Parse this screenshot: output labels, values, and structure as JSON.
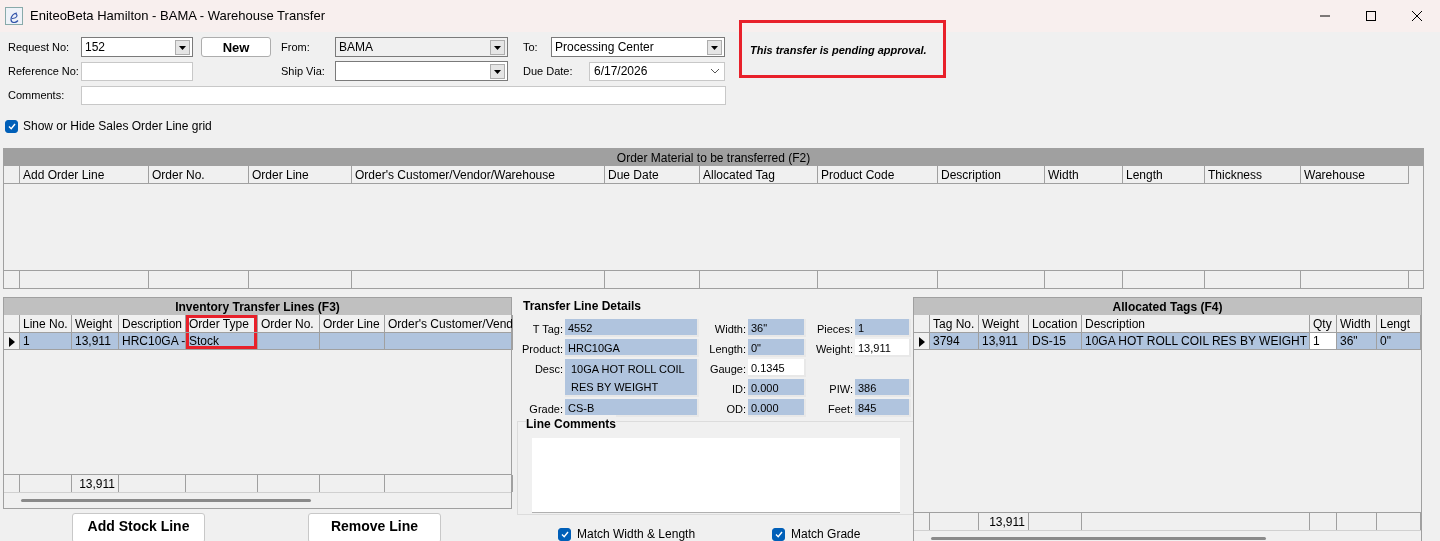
{
  "window": {
    "title": "EniteoBeta Hamilton - BAMA - Warehouse Transfer"
  },
  "header_form": {
    "request_no": {
      "label": "Request No:",
      "value": "152"
    },
    "new_button": "New",
    "from": {
      "label": "From:",
      "value": "BAMA",
      "disabled": true
    },
    "to": {
      "label": "To:",
      "value": "Processing Center",
      "disabled": false
    },
    "reference_no": {
      "label": "Reference No:"
    },
    "ship_via": {
      "label": "Ship Via:",
      "disabled": false
    },
    "due_date": {
      "label": "Due Date:",
      "value": "6/17/2026"
    },
    "comments": {
      "label": "Comments:"
    }
  },
  "notice": {
    "text": "This transfer is pending approval.",
    "highlighted": true
  },
  "show_grid_checkbox": {
    "label": "Show or Hide Sales Order Line grid",
    "checked": true
  },
  "order_material_grid": {
    "title": "Order Material to be transferred (F2)",
    "columns": [
      {
        "label": "Add Order Line"
      },
      {
        "label": "Order No."
      },
      {
        "label": "Order Line"
      },
      {
        "label": "Order's Customer/Vendor/Warehouse"
      },
      {
        "label": "Due Date"
      },
      {
        "label": "Allocated Tag"
      },
      {
        "label": "Product Code"
      },
      {
        "label": "Description"
      },
      {
        "label": "Width"
      },
      {
        "label": "Length"
      },
      {
        "label": "Thickness"
      },
      {
        "label": "Warehouse"
      }
    ]
  },
  "transfer_lines_grid": {
    "title": "Inventory Transfer Lines (F3)",
    "columns": [
      {
        "label": "Line No.",
        "highlighted": false
      },
      {
        "label": "Weight",
        "highlighted": false
      },
      {
        "label": "Description",
        "highlighted": false
      },
      {
        "label": "Order Type",
        "highlighted": true
      },
      {
        "label": "Order No.",
        "highlighted": false
      },
      {
        "label": "Order Line",
        "highlighted": false
      },
      {
        "label": "Order's Customer/Vend",
        "highlighted": false
      }
    ],
    "rows": [
      {
        "selected": true,
        "cells": [
          "1",
          "13,911",
          "HRC10GA -",
          "Stock"
        ]
      }
    ],
    "weight_total": "13,911"
  },
  "transfer_line_details": {
    "title": "Transfer Line Details",
    "fields": [
      {
        "label": "T Tag:",
        "value": "4552",
        "editable": false
      },
      {
        "label": "Width:",
        "value": "36\"",
        "editable": false
      },
      {
        "label": "Pieces:",
        "value": "1",
        "editable": false
      },
      {
        "label": "Product:",
        "value": "HRC10GA",
        "editable": false
      },
      {
        "label": "Length:",
        "value": "0\"",
        "editable": false
      },
      {
        "label": "Weight:",
        "value": "13,911",
        "editable": true
      },
      {
        "label": "Desc:",
        "value": "10GA HOT ROLL COIL RES BY WEIGHT",
        "editable": false
      },
      {
        "label": "Gauge:",
        "value": "0.1345",
        "editable": true
      },
      {
        "label": "ID:",
        "value": "0.000",
        "editable": false
      },
      {
        "label": "PIW:",
        "value": "386",
        "editable": false
      },
      {
        "label": "Grade:",
        "value": "CS-B",
        "editable": false
      },
      {
        "label": "OD:",
        "value": "0.000",
        "editable": false
      },
      {
        "label": "Feet:",
        "value": "845",
        "editable": false
      }
    ],
    "line_comments": {
      "title": "Line Comments"
    }
  },
  "allocated_tags_grid": {
    "title": "Allocated Tags (F4)",
    "columns": [
      {
        "label": "Tag No.",
        "highlighted": false,
        "editable": false
      },
      {
        "label": "Weight",
        "highlighted": false,
        "editable": false
      },
      {
        "label": "Location",
        "highlighted": false,
        "editable": false
      },
      {
        "label": "Description",
        "highlighted": false,
        "editable": false
      },
      {
        "label": "Qty",
        "highlighted": false,
        "editable": true
      },
      {
        "label": "Width",
        "highlighted": false,
        "editable": false
      },
      {
        "label": "Lengt",
        "highlighted": false,
        "editable": false
      }
    ],
    "rows": [
      {
        "selected": true,
        "cells": [
          "3794",
          "13,911",
          "DS-15",
          "10GA HOT ROLL COIL RES BY WEIGHT",
          "1",
          "36\"",
          "0\""
        ]
      }
    ],
    "weight_total": "13,911"
  },
  "buttons": [
    {
      "label": "Add Stock Line"
    },
    {
      "label": "Remove Line"
    }
  ],
  "match_checkboxes": [
    {
      "label": "Match Width & Length",
      "checked": true
    },
    {
      "label": "Match Grade",
      "checked": true
    }
  ]
}
